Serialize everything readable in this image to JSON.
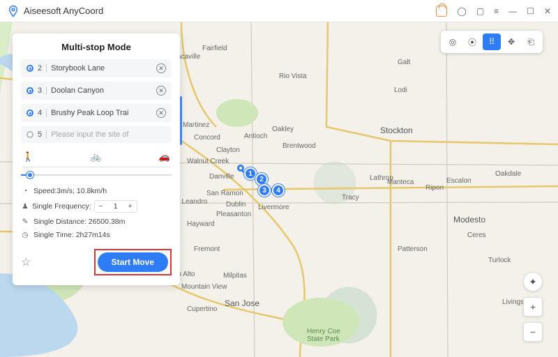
{
  "app": {
    "title": "Aiseesoft AnyCoord"
  },
  "panel": {
    "title": "Multi-stop Mode",
    "stops": [
      {
        "num": "2",
        "name": "Storybook Lane",
        "filled": true
      },
      {
        "num": "3",
        "name": "Doolan Canyon",
        "filled": true
      },
      {
        "num": "4",
        "name": "Brushy Peak Loop Trai",
        "filled": true
      },
      {
        "num": "5",
        "name": "Please input the site of",
        "filled": false
      }
    ],
    "speed_label": "Speed:3m/s; 10.8km/h",
    "freq_label": "Single Frequency:",
    "freq_value": "1",
    "distance_label": "Single Distance: 26500.38m",
    "time_label": "Single Time: 2h27m14s",
    "start_label": "Start Move"
  },
  "cities": {
    "fairfield": "Fairfield",
    "riovista": "Rio Vista",
    "vacaville": "Vacaville",
    "martinez": "Martinez",
    "concord": "Concord",
    "antioch": "Antioch",
    "brentwood": "Brentwood",
    "clayton": "Clayton",
    "oakley": "Oakley",
    "walnutcreek": "Walnut Creek",
    "danville": "Danville",
    "sanramon": "San Ramon",
    "dublin": "Dublin",
    "livermore": "Livermore",
    "pleasanton": "Pleasanton",
    "hayward": "Hayward",
    "fremont": "Fremont",
    "paloalto": "Palo Alto",
    "mountainview": "Mountain View",
    "milpitas": "Milpitas",
    "sanjose": "San Jose",
    "cupertino": "Cupertino",
    "stockton": "Stockton",
    "tracy": "Tracy",
    "manteca": "Manteca",
    "lodi": "Lodi",
    "galt": "Galt",
    "ripon": "Ripon",
    "escalon": "Escalon",
    "lathrop": "Lathrop",
    "modesto": "Modesto",
    "patterson": "Patterson",
    "livingston": "Livingston",
    "turlock": "Turlock",
    "ceres": "Ceres",
    "oakdale": "Oakdale",
    "leandro": "in Leandro",
    "henrycoe": "Henry Coe\nState Park"
  },
  "waypoints": {
    "w1": "1",
    "w2": "2",
    "w3": "3",
    "w4": "4"
  }
}
